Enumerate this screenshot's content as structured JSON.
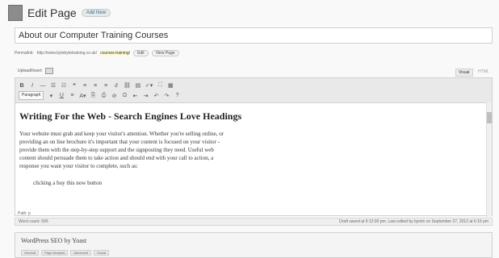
{
  "header": {
    "title": "Edit Page",
    "add_new": "Add New"
  },
  "post": {
    "title": "About our  Computer Training Courses",
    "permalink_label": "Permalink:",
    "permalink_url": "http://www.bytebytetraining.co.uk/",
    "permalink_slug": "courses-training/",
    "edit_button": "Edit",
    "view_button": "View Page"
  },
  "media": {
    "upload_label": "Upload/Insert"
  },
  "editor_tabs": {
    "visual": "Visual",
    "html": "HTML"
  },
  "toolbar": {
    "row1": [
      "B",
      "I",
      "—",
      "☰",
      "☷",
      "❝",
      "≡",
      "≡",
      "≡",
      "∂",
      "⛓",
      "▤",
      "✓▾",
      "⛶",
      "▦"
    ],
    "row2_paragraph": "Paragraph",
    "row2": [
      "▾",
      "U",
      "≡",
      "A▾",
      "⎘",
      "⎙",
      "⊘",
      "Ω",
      "⇤",
      "⇥",
      "↶",
      "↷",
      "?"
    ]
  },
  "content": {
    "heading": "Writing For the Web - Search Engines Love Headings",
    "lines": [
      "Your website must grab and keep your visitor's attention. Whether you're selling online, or",
      "providing an on line brochure it's important that your content is focused on your visitor -",
      "provide them with the step-by-step support and the signposting they need. Useful web",
      "content should persuade them to take action and should end with your call to action, a",
      "response you want your visitor to complete, such as:"
    ],
    "list_item": "clicking a buy this now button"
  },
  "status": {
    "path": "Path: p",
    "word_count": "Word count: 596",
    "draft_saved": "Draft saved at 9:12:00 pm. Last edited by bymin on September 27, 2012 at 6:15 pm"
  },
  "seo": {
    "title": "WordPress SEO by Yoast",
    "tabs": [
      "General",
      "Page Analysis",
      "Advanced",
      "Social"
    ]
  }
}
